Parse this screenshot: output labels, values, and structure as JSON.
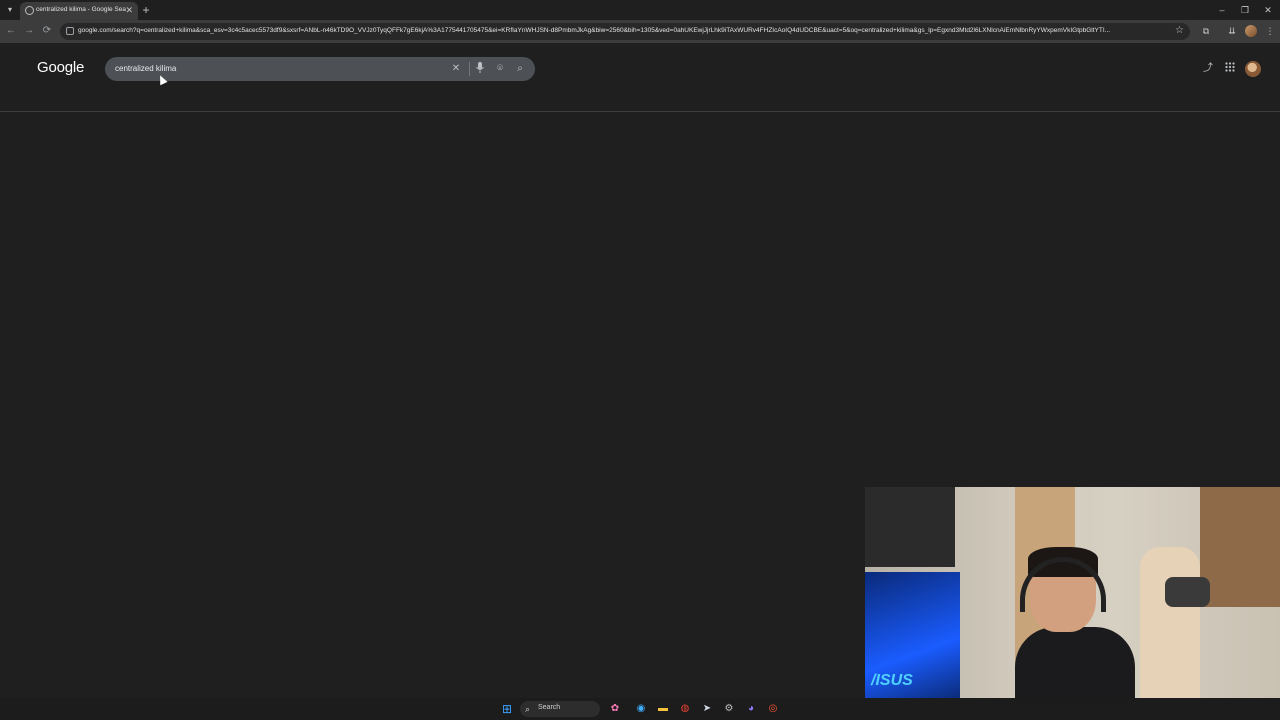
{
  "tab": {
    "title": "centralized kilima - Google Sea",
    "close_glyph": "✕",
    "new_tab_glyph": "+"
  },
  "window": {
    "minimize": "–",
    "restore": "❐",
    "close": "✕"
  },
  "address_bar": {
    "url": "google.com/search?q=centralized+kilima&sca_esv=3c4c5acec5573df9&sxsrf=ANbL-n46kTD9O_VVJz0TyqQFFk7gE6kjA%3A1775441705475&ei=KRfIaYnWHJSN-d8PmbmJkAg&biw=2560&bih=1305&ved=0ahUKEwjJjrLhk9iTAxWURv4FHZIcAoIQ4dUDCBE&uact=5&oq=centralized+kilima&gs_lp=Egxnd3Mtd2l6LXNlcnAiEmNlbnRyYWxpemVkIGtpbGltYTI..."
  },
  "google": {
    "logo": "Google",
    "query": "centralized kilima"
  },
  "taskbar": {
    "search_label": "Search"
  },
  "icons": {
    "back": "←",
    "forward": "→",
    "reload": "⟳",
    "site_info": "site-info-icon",
    "star": "☆",
    "clear": "✕",
    "mic": "🎤",
    "lens": "⌾",
    "search": "⌕",
    "share": "⤴",
    "apps": "⋮⋮",
    "windows": "⊞",
    "menu": "⋮"
  }
}
